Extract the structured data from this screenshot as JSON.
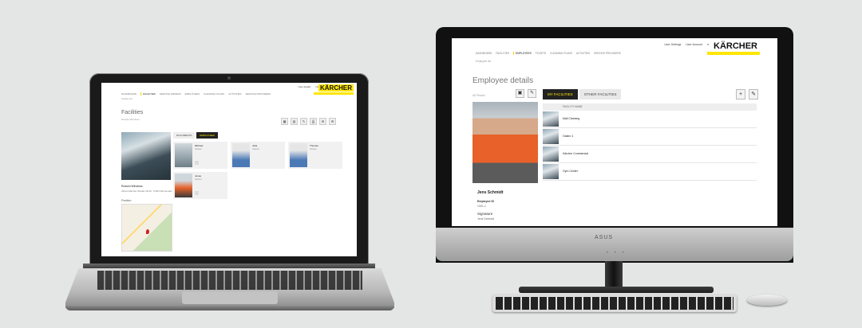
{
  "brand": {
    "name": "KÄRCHER",
    "accent": "#ffe600"
  },
  "laptop": {
    "top_links": [
      "User details",
      "User account"
    ],
    "nav": [
      "DASHBOARD",
      "FACILITIES",
      "SERVICE ORDERS",
      "EMPLOYEES",
      "CLEANING PLANS",
      "ACTIVITIES",
      "SERVICE PROVIDERS"
    ],
    "breadcrumb": "Facility list",
    "title": "Facilities",
    "subtitle": "Rossini Windows",
    "tool_icons": [
      "icon-1",
      "icon-2",
      "icon-3",
      "icon-4",
      "icon-5",
      "icon-6"
    ],
    "facility": {
      "title": "Rossini Windows",
      "address": "Alfred-Kärcher-Straße 28-40, 71364 Winnenden"
    },
    "map_label": "Position",
    "tabs": [
      "DOCUMENTS",
      "EMPLOYEES"
    ],
    "active_tab": 1,
    "employees": [
      {
        "name": "Michael",
        "role": "Cleaner"
      },
      {
        "name": "Julia",
        "role": "Cleaner"
      },
      {
        "name": "Thomas",
        "role": "Cleaner"
      },
      {
        "name": "Jonas",
        "role": "Cleaner"
      }
    ]
  },
  "monitor": {
    "top_links": [
      "User Settings",
      "User Account"
    ],
    "nav": [
      "DASHBOARD",
      "FACILITIES",
      "EMPLOYEES",
      "TICKETS",
      "CLEANING PLANS",
      "ACTIVITIES",
      "SERVICE PROVIDERS"
    ],
    "breadcrumb": "Employee list",
    "title": "Employee details",
    "photo_label": "All Photos",
    "tabs": [
      "MY FACILITIES",
      "OTHER FACILITIES"
    ],
    "active_tab": 0,
    "list_header": "FACILITY NAME",
    "facilities": [
      "Mall Cleaning",
      "Gastro 1",
      "Kärcher Commercial",
      "Gym Center"
    ],
    "employee": {
      "name": "Jens Schmidt",
      "field1_label": "Employee ID",
      "field1_value": "1001-1",
      "field2_label": "Signature",
      "field2_value": "Jens Schmidt"
    },
    "logo": "ASUS"
  }
}
